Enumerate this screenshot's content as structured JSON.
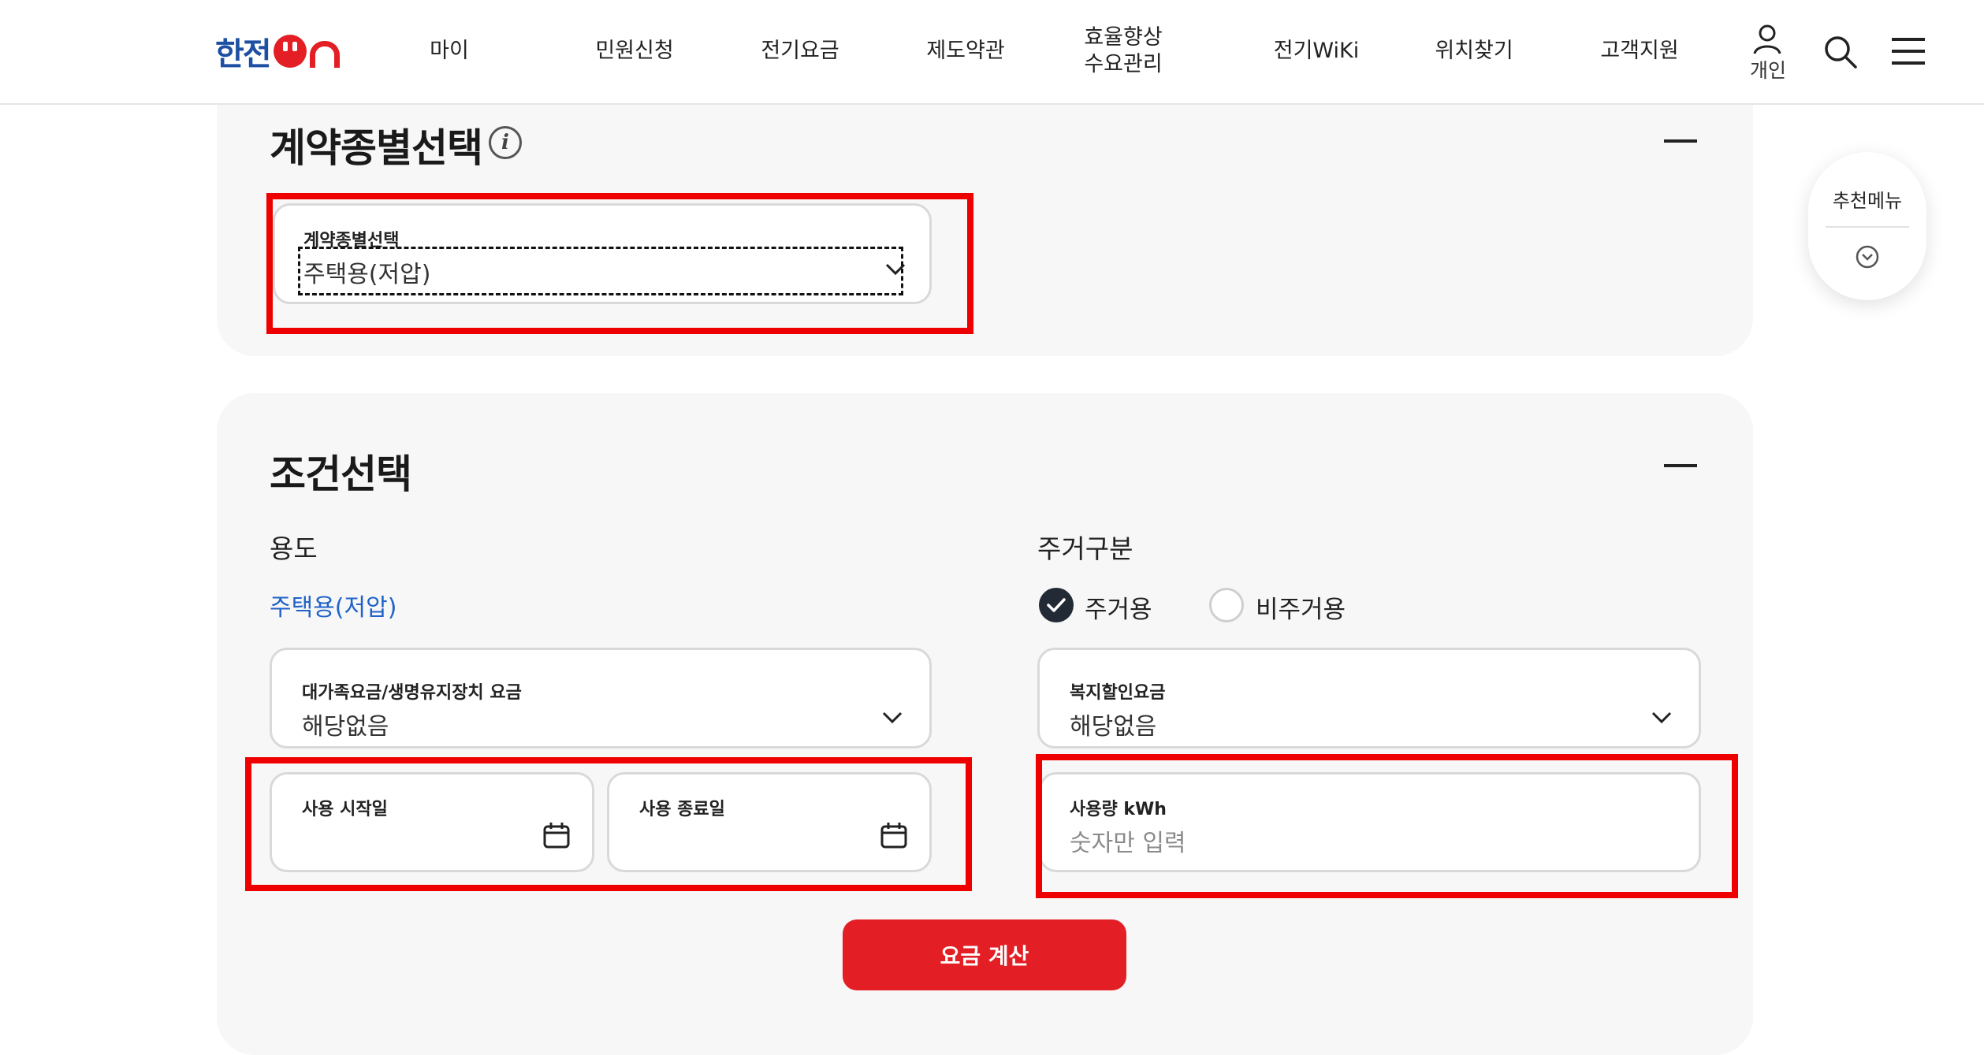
{
  "header": {
    "logo_text": "한전",
    "nav": [
      {
        "label": "마이"
      },
      {
        "label": "민원신청"
      },
      {
        "label": "전기요금"
      },
      {
        "label": "제도약관"
      },
      {
        "label_line1": "효율향상",
        "label_line2": "수요관리"
      },
      {
        "label": "전기WiKi"
      },
      {
        "label": "위치찾기"
      },
      {
        "label": "고객지원"
      }
    ],
    "personal_label": "개인"
  },
  "contract_section": {
    "title": "계약종별선택",
    "select": {
      "label": "계약종별선택",
      "value": "주택용(저압)"
    }
  },
  "condition_section": {
    "title": "조건선택",
    "usage": {
      "label": "용도",
      "value": "주택용(저압)"
    },
    "residence": {
      "label": "주거구분",
      "options": [
        {
          "label": "주거용",
          "selected": true
        },
        {
          "label": "비주거용",
          "selected": false
        }
      ]
    },
    "family_fee": {
      "label": "대가족요금/생명유지장치 요금",
      "value": "해당없음"
    },
    "welfare_fee": {
      "label": "복지할인요금",
      "value": "해당없음"
    },
    "start_date": {
      "label": "사용 시작일"
    },
    "end_date": {
      "label": "사용 종료일"
    },
    "usage_kwh": {
      "label": "사용량 kWh",
      "placeholder": "숫자만 입력"
    },
    "calc_button": "요금 계산"
  },
  "float_menu": {
    "label": "추천메뉴"
  },
  "colors": {
    "brand_red": "#e31e24",
    "brand_blue": "#1d4fa3",
    "link_blue": "#1f63c8",
    "highlight_red": "#ee0000"
  }
}
